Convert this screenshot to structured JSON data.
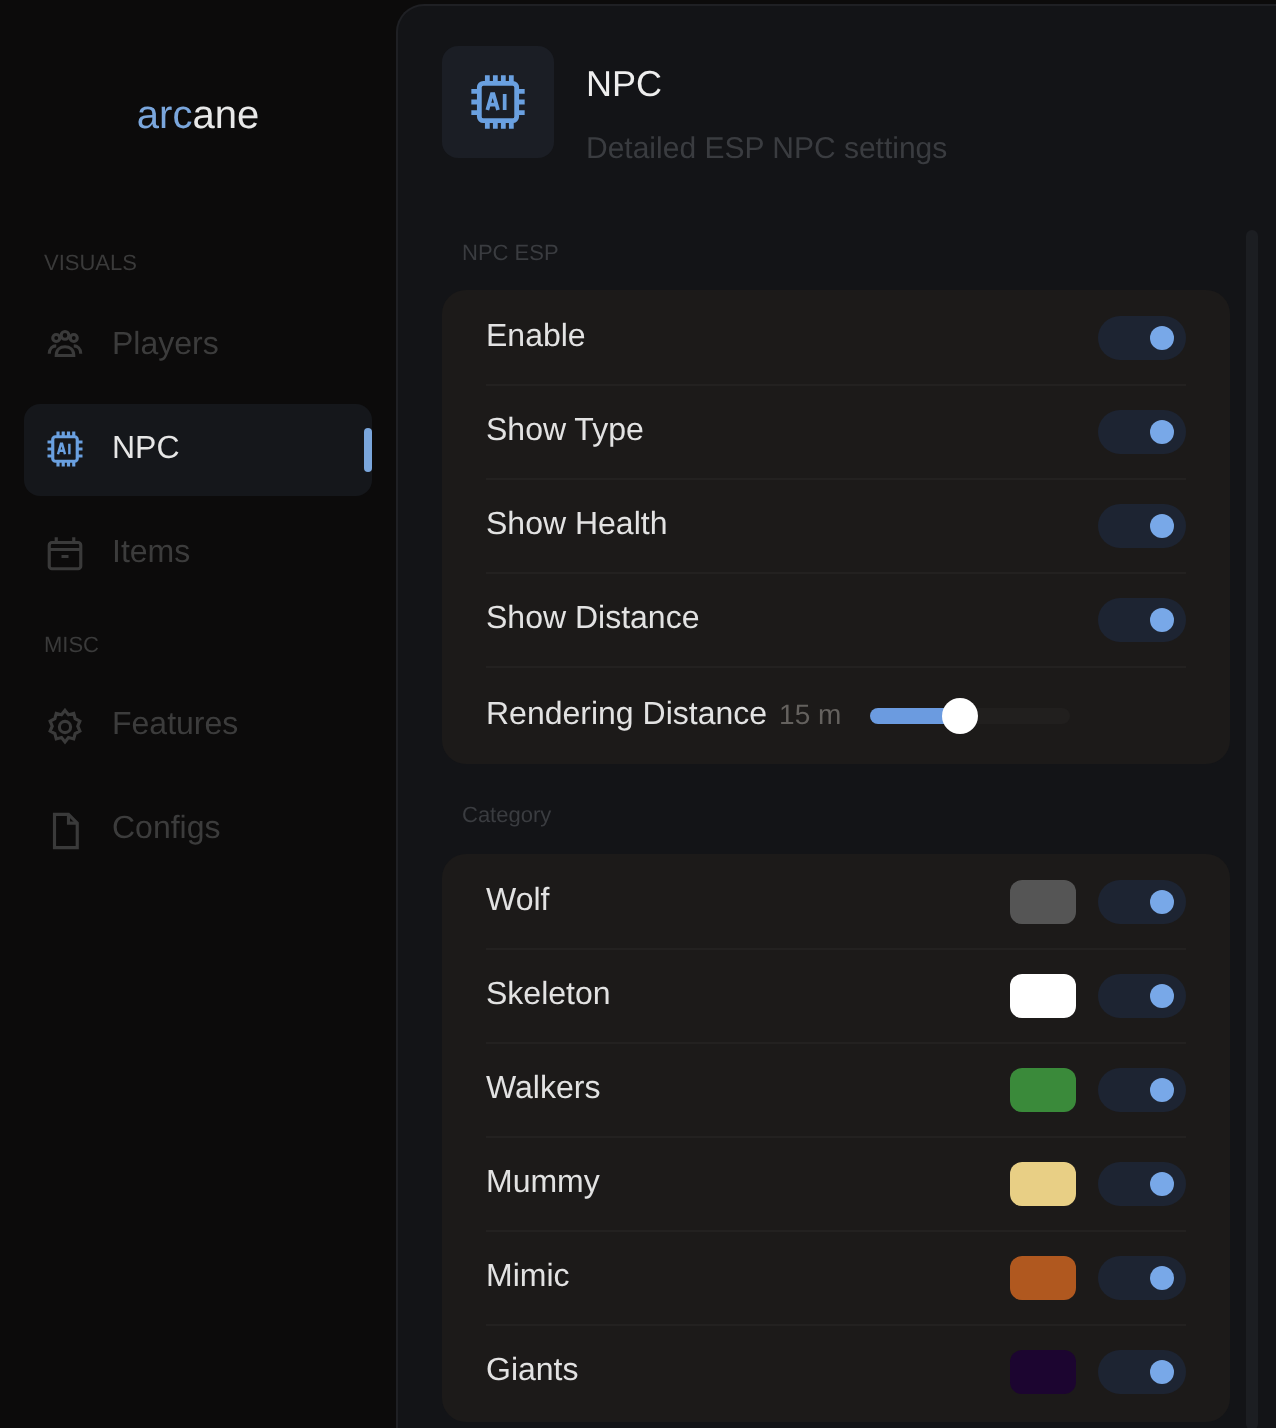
{
  "sidebar": {
    "logo": {
      "accent": "arc",
      "rest": "ane"
    },
    "sections": [
      {
        "label": "VISUALS",
        "items": [
          {
            "label": "Players",
            "selected": false
          },
          {
            "label": "NPC",
            "selected": true
          },
          {
            "label": "Items",
            "selected": false
          }
        ]
      },
      {
        "label": "MISC",
        "items": [
          {
            "label": "Features",
            "selected": false
          },
          {
            "label": "Configs",
            "selected": false
          }
        ]
      }
    ]
  },
  "header": {
    "title": "NPC",
    "subtitle": "Detailed ESP NPC settings"
  },
  "groups": [
    {
      "label": "NPC ESP",
      "rows": [
        {
          "kind": "toggle",
          "label": "Enable",
          "on": true
        },
        {
          "kind": "toggle",
          "label": "Show Type",
          "on": true
        },
        {
          "kind": "toggle",
          "label": "Show Health",
          "on": true
        },
        {
          "kind": "toggle",
          "label": "Show Distance",
          "on": true
        },
        {
          "kind": "slider",
          "label": "Rendering Distance",
          "reading": "15 m",
          "level": 0.45
        }
      ]
    },
    {
      "label": "Category",
      "rows": [
        {
          "kind": "color_toggle",
          "label": "Wolf",
          "color": "#555555",
          "on": true
        },
        {
          "kind": "color_toggle",
          "label": "Skeleton",
          "color": "#ffffff",
          "on": true
        },
        {
          "kind": "color_toggle",
          "label": "Walkers",
          "color": "#3a8a3a",
          "on": true
        },
        {
          "kind": "color_toggle",
          "label": "Mummy",
          "color": "#e8cf85",
          "on": true
        },
        {
          "kind": "color_toggle",
          "label": "Mimic",
          "color": "#b0581f",
          "on": true
        },
        {
          "kind": "color_toggle",
          "label": "Giants",
          "color": "#1c0530",
          "on": true
        }
      ]
    }
  ]
}
